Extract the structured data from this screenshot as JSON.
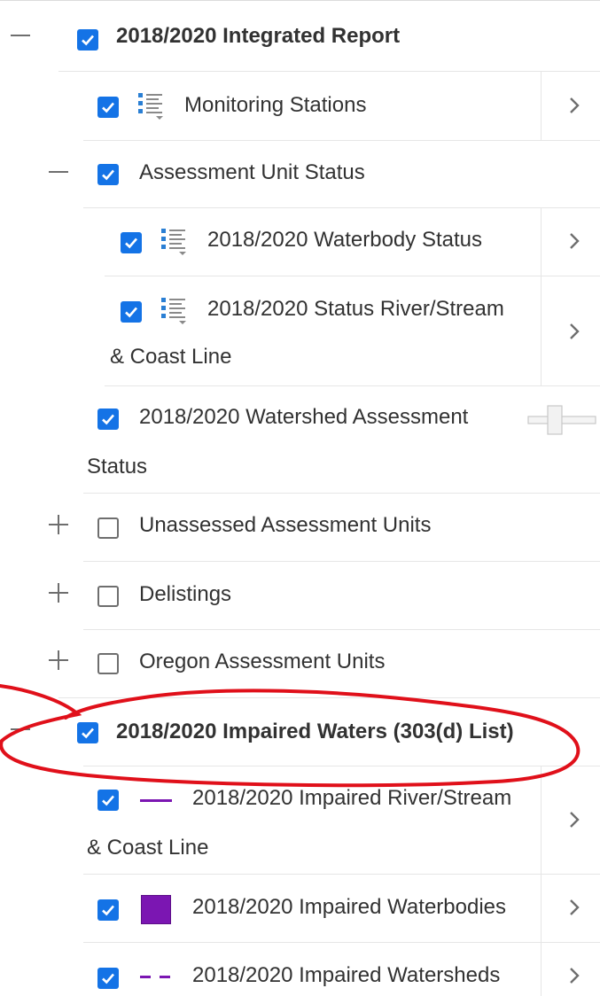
{
  "layers": {
    "integrated_report": {
      "label": "2018/2020 Integrated Report",
      "checked": true
    },
    "monitoring_stations": {
      "label": "Monitoring Stations",
      "checked": true
    },
    "assessment_unit_status": {
      "label": "Assessment Unit Status",
      "checked": true
    },
    "waterbody_status": {
      "label": "2018/2020 Waterbody Status",
      "checked": true
    },
    "status_river_stream": {
      "label_line1": "2018/2020 Status River/Stream",
      "label_line2": "& Coast Line",
      "checked": true
    },
    "watershed_assessment": {
      "label_line1": "2018/2020 Watershed Assessment",
      "label_line2": "Status",
      "checked": true
    },
    "unassessed_units": {
      "label": "Unassessed Assessment Units",
      "checked": false
    },
    "delistings": {
      "label": "Delistings",
      "checked": false
    },
    "oregon_units": {
      "label": "Oregon Assessment Units",
      "checked": false
    },
    "impaired_waters": {
      "label": "2018/2020 Impaired Waters (303(d) List)",
      "checked": true
    },
    "impaired_river_stream": {
      "label_line1": "2018/2020 Impaired River/Stream",
      "label_line2": "& Coast Line",
      "checked": true
    },
    "impaired_waterbodies": {
      "label": "2018/2020 Impaired Waterbodies",
      "checked": true
    },
    "impaired_watersheds": {
      "label": "2018/2020 Impaired Watersheds",
      "checked": true
    }
  },
  "icons": {
    "collapse": "minus-icon",
    "expand": "plus-icon",
    "legend": "legend-list-icon",
    "chevron": "chevron-right-icon",
    "opacity": "opacity-slider"
  },
  "colors": {
    "checkbox_checked": "#1473e6",
    "impaired_purple": "#7b16b2",
    "annotation_red": "#e0101a"
  }
}
